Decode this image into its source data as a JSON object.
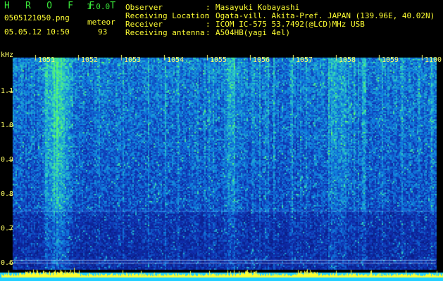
{
  "header": {
    "app_name": "H R O F F T",
    "version": "1.0.0",
    "filename": "0505121050.png",
    "datetime": "05.05.12 10:50",
    "mode": "meteor",
    "count": "93",
    "info": [
      {
        "label": "Observer",
        "value": "Masayuki Kobayashi"
      },
      {
        "label": "Receiving Location",
        "value": "Ogata-vill. Akita-Pref. JAPAN (139.96E, 40.02N)"
      },
      {
        "label": "Receiver",
        "value": "ICOM IC-575 53.7492(@LCD)MHz USB"
      },
      {
        "label": "Receiving antenna",
        "value": "A504HB(yagi 4el)"
      }
    ]
  },
  "chart_data": {
    "type": "heatmap",
    "y_unit": "kHz",
    "y_ticks": [
      "1.1",
      "1.0",
      "0.9",
      "0.8",
      "0.7",
      "0.6"
    ],
    "y_tick_values": [
      1.1,
      1.0,
      0.9,
      0.8,
      0.7,
      0.6
    ],
    "ylim": [
      0.58,
      1.2
    ],
    "x_ticks": [
      "1051",
      "1052",
      "1053",
      "1054",
      "1055",
      "1056",
      "1057",
      "1058",
      "1059",
      "1100"
    ],
    "xlim": [
      "10:50",
      "11:00"
    ],
    "colors": {
      "background": "#0a1a80",
      "low": "#1030b0",
      "mid": "#1080e0",
      "high": "#30d0c0",
      "peak": "#60ff60",
      "baseline_band": "#20d0ff",
      "baseline_spike": "#ffff33"
    }
  }
}
